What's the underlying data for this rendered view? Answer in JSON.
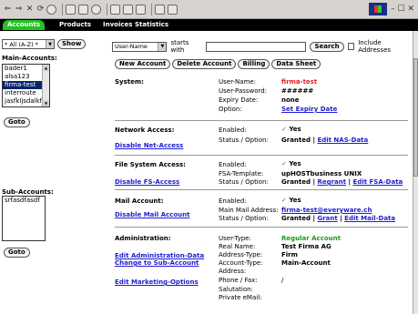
{
  "toolbar": {
    "nav_glyphs": [
      "⇐",
      "⇒",
      "✕",
      "⟳"
    ],
    "win_controls": "– ☐ ✕"
  },
  "tabs": [
    {
      "label": "Accounts",
      "active": true
    },
    {
      "label": "Products",
      "active": false
    },
    {
      "label": "Invoices",
      "active": false
    },
    {
      "label": "Statistics",
      "active": false
    }
  ],
  "left": {
    "filter_value": "* All (A-Z) *",
    "show_button": "Show",
    "main_accounts_label": "Main-Accounts:",
    "main_accounts": [
      {
        "name": "bader1",
        "selected": false
      },
      {
        "name": "alsa123",
        "selected": false
      },
      {
        "name": "firma-test",
        "selected": true
      },
      {
        "name": "interroute",
        "selected": false
      },
      {
        "name": "jasfkljsdalkf",
        "selected": false
      }
    ],
    "goto_button": "Goto",
    "sub_accounts_label": "Sub-Accounts:",
    "sub_accounts": [
      "srfasdfasdf"
    ],
    "goto_button_2": "Goto"
  },
  "main": {
    "search_field_value": "User-Name",
    "starts_with": "starts with",
    "search_button": "Search",
    "include_addresses": "Include Addresses",
    "actions": {
      "new_account": "New Account",
      "delete_account": "Delete Account",
      "billing": "Billing",
      "data_sheet": "Data Sheet"
    },
    "system": {
      "title": "System:",
      "user_name_label": "User-Name:",
      "user_name": "firma-test",
      "user_password_label": "User-Password:",
      "user_password": "######",
      "expiry_label": "Expiry Date:",
      "expiry": "none",
      "option_label": "Option:",
      "option_link": "Set Expiry Date"
    },
    "network": {
      "title": "Network Access:",
      "link": "Disable Net-Access",
      "enabled_label": "Enabled:",
      "enabled": "Yes",
      "status_label": "Status / Option:",
      "status": "Granted",
      "status_link": "Edit NAS-Data"
    },
    "filesystem": {
      "title": "File System Access:",
      "link": "Disable FS-Access",
      "enabled_label": "Enabled:",
      "enabled": "Yes",
      "template_label": "FSA-Template:",
      "template": "upHOSTbusiness UNIX",
      "status_label": "Status / Option:",
      "status": "Granted",
      "status_link_1": "Regrant",
      "status_link_2": "Edit FSA-Data"
    },
    "mail": {
      "title": "Mail Account:",
      "link": "Disable Mail Account",
      "enabled_label": "Enabled:",
      "enabled": "Yes",
      "address_label": "Main Mail Address:",
      "address": "firma-test@everyware.ch",
      "status_label": "Status / Option:",
      "status": "Granted",
      "status_link_1": "Grant",
      "status_link_2": "Edit Mail-Data"
    },
    "administration": {
      "title": "Administration:",
      "link_1": "Edit Administration-Data",
      "link_2": "Change to Sub-Account",
      "link_3": "Edit Marketing-Options",
      "user_type_label": "User-Type:",
      "user_type": "Regular Account",
      "real_name_label": "Real Name:",
      "real_name": "Test Firma AG",
      "address_type_label": "Address-Type:",
      "address_type": "Firm",
      "account_type_label": "Account-Type:",
      "account_type": "Main-Account",
      "address_label": "Address:",
      "phone_label": "Phone / Fax:",
      "phone_value": "/",
      "salutation_label": "Salutation:",
      "private_email_label": "Private eMail:"
    }
  }
}
